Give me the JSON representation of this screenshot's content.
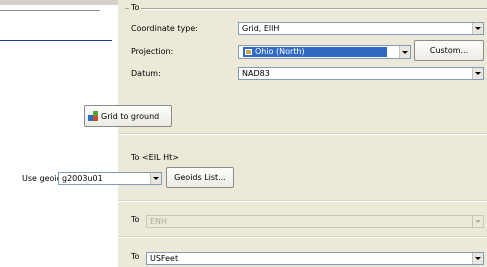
{
  "to_section_1": {
    "header": "To",
    "coordinate_type_label": "Coordinate type:",
    "coordinate_type_value": "Grid, EllH",
    "projection_label": "Projection:",
    "projection_value": "Ohio (North)",
    "custom_button": "Custom...",
    "datum_label": "Datum:",
    "datum_value": "NAD83",
    "grid_to_ground_button": "Grid to ground"
  },
  "to_section_2": {
    "header": "To <EIL Ht>",
    "use_geoid_label": "Use geoid",
    "geoid_value": "g2003u01",
    "geoids_list_button": "Geoids List..."
  },
  "to_section_3": {
    "label": "To",
    "value": "ENH"
  },
  "to_section_4": {
    "label": "To",
    "value": "USFeet"
  }
}
